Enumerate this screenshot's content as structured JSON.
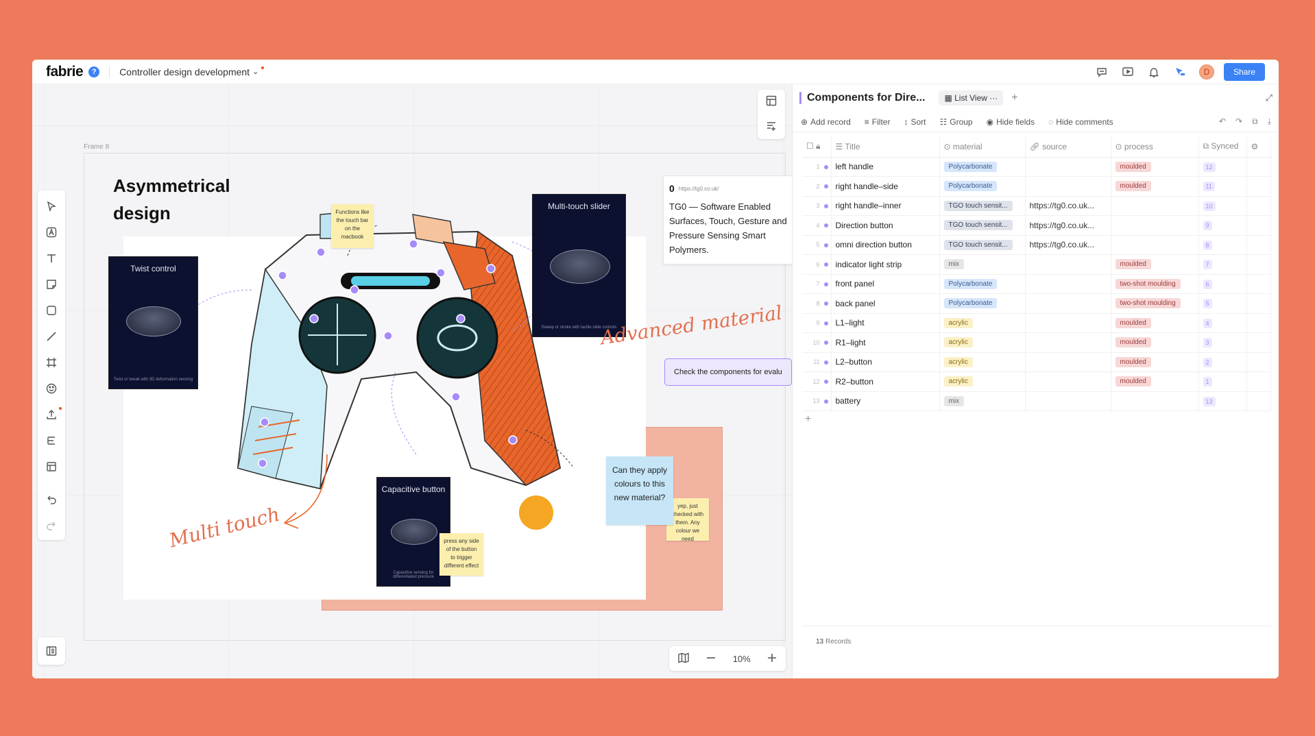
{
  "app": {
    "logo": "fabrie",
    "help": "?",
    "doc_title": "Controller design development",
    "avatar_initial": "D",
    "share_label": "Share"
  },
  "canvas": {
    "frame_label": "Frame 8",
    "heading": "Asymmetrical design",
    "zoom": "10%",
    "twist_card": {
      "title": "Twist control",
      "sub": "Twist or tweak with 3D deformation sensing"
    },
    "slider_card": {
      "title": "Multi-touch slider",
      "sub": "Sweep or stroke with tactile slide controls"
    },
    "capacitive_card": {
      "title": "Capacitive button",
      "sub": "Capacitive sensing for differentiated pressure"
    },
    "sticky_functions": "Functions like the touch bar on the macbook",
    "sticky_press": "press any side of the button to trigger different effect",
    "sticky_yep": "yep, just checked with them. Any colour we need",
    "link_card": {
      "url": "https://tg0.co.uk/",
      "icon": "0",
      "text": "TG0 — Software Enabled Surfaces, Touch, Gesture and Pressure Sensing Smart Polymers."
    },
    "check_card": "Check the components for evalu",
    "blue_card": "Can they apply colours to this new material?",
    "script_advanced": "Advanced material",
    "script_multitouch": "Multi touch"
  },
  "panel": {
    "title": "Components for Dire...",
    "view_label": "List View",
    "toolbar": {
      "add_record": "Add record",
      "filter": "Filter",
      "sort": "Sort",
      "group": "Group",
      "hide_fields": "Hide fields",
      "hide_comments": "Hide comments"
    },
    "columns": {
      "title": "Title",
      "material": "material",
      "source": "source",
      "process": "process",
      "synced": "Synced"
    },
    "rows": [
      {
        "idx": "1",
        "title": "left handle",
        "material": "Polycarbonate",
        "source": "",
        "process": "moulded",
        "synced": "12"
      },
      {
        "idx": "2",
        "title": "right handle–side",
        "material": "Polycarbonate",
        "source": "",
        "process": "moulded",
        "synced": "11"
      },
      {
        "idx": "3",
        "title": "right handle–inner",
        "material": "TGO touch sensit...",
        "source": "https://tg0.co.uk...",
        "process": "",
        "synced": "10"
      },
      {
        "idx": "4",
        "title": "Direction button",
        "material": "TGO touch sensit...",
        "source": "https://tg0.co.uk...",
        "process": "",
        "synced": "9"
      },
      {
        "idx": "5",
        "title": "omni direction button",
        "material": "TGO touch sensit...",
        "source": "https://tg0.co.uk...",
        "process": "",
        "synced": "8"
      },
      {
        "idx": "6",
        "title": "indicator light strip",
        "material": "mix",
        "source": "",
        "process": "moulded",
        "synced": "7"
      },
      {
        "idx": "7",
        "title": "front panel",
        "material": "Polycarbonate",
        "source": "",
        "process": "two-shot moulding",
        "synced": "6"
      },
      {
        "idx": "8",
        "title": "back panel",
        "material": "Polycarbonate",
        "source": "",
        "process": "two-shot moulding",
        "synced": "5"
      },
      {
        "idx": "9",
        "title": "L1–light",
        "material": "acrylic",
        "source": "",
        "process": "moulded",
        "synced": "4"
      },
      {
        "idx": "10",
        "title": "R1–light",
        "material": "acrylic",
        "source": "",
        "process": "moulded",
        "synced": "3"
      },
      {
        "idx": "11",
        "title": "L2–button",
        "material": "acrylic",
        "source": "",
        "process": "moulded",
        "synced": "2"
      },
      {
        "idx": "12",
        "title": "R2–button",
        "material": "acrylic",
        "source": "",
        "process": "moulded",
        "synced": "1"
      },
      {
        "idx": "13",
        "title": "battery",
        "material": "mix",
        "source": "",
        "process": "",
        "synced": "13"
      }
    ],
    "footer_count": "13",
    "footer_label": "Records"
  },
  "colors": {
    "background": "#ec7a5b",
    "accent": "#3b82f6",
    "purple": "#a78bfa",
    "orange": "#e8662b"
  }
}
